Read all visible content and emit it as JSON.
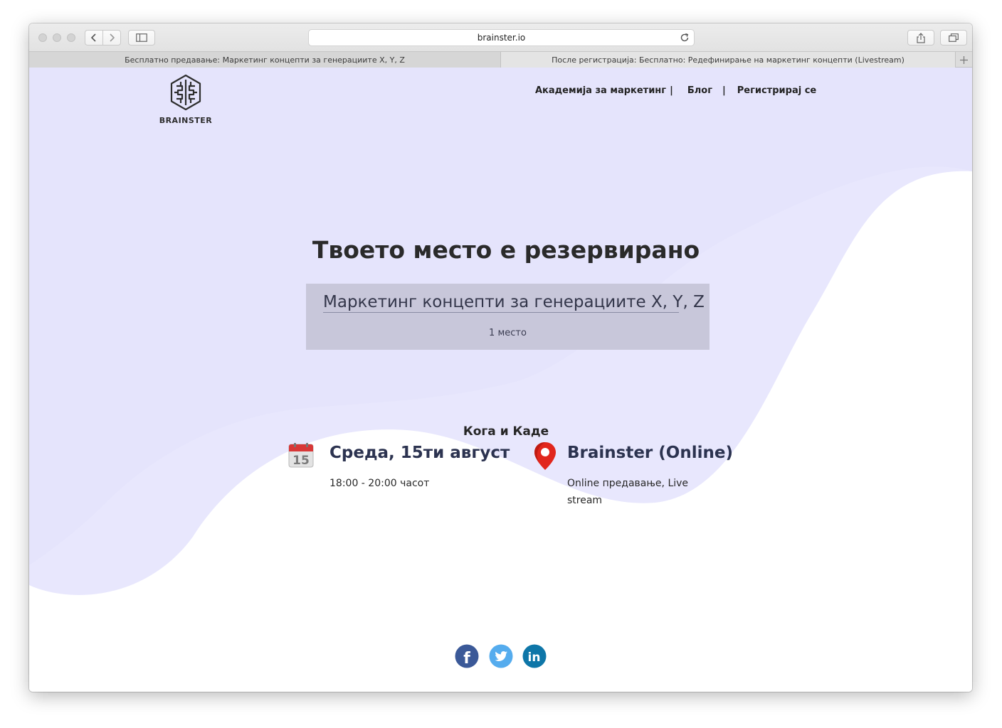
{
  "browser": {
    "url": "brainster.io",
    "tabs": [
      {
        "label": "Бесплатно предавање: Маркетинг концепти за генерациите X, Y, Z"
      },
      {
        "label": "После регистрација: Бесплатно: Редефинирање на маркетинг концепти (Livestream)"
      }
    ]
  },
  "header": {
    "logo_text": "BRAINSTER",
    "nav": [
      {
        "label": "Академија за маркетинг"
      },
      {
        "label": "Блог"
      },
      {
        "label": "Регистрирај се"
      }
    ],
    "separator": "|"
  },
  "main": {
    "headline": "Твоето место е резервирано",
    "event": {
      "title": "Маркетинг концепти за генерациите X, Y, Z",
      "seats": "1 место"
    },
    "section_title": "Кога и Каде",
    "date": {
      "icon": "calendar-icon",
      "day_number": "15",
      "title": "Среда, 15ти август",
      "time": "18:00 - 20:00 часот"
    },
    "location": {
      "icon": "map-pin-icon",
      "title": "Brainster (Online)",
      "description": "Online предавање, Live stream"
    }
  },
  "footer": {
    "social": [
      {
        "icon": "facebook-icon",
        "glyph": "f",
        "color": "#3b5998"
      },
      {
        "icon": "twitter-icon",
        "color": "#55acee"
      },
      {
        "icon": "linkedin-icon",
        "glyph": "in",
        "color": "#0e76a8"
      }
    ]
  },
  "colors": {
    "wave_fill": "#e8e7fd",
    "event_box": "#c8c7da",
    "heading": "#2c3350"
  }
}
